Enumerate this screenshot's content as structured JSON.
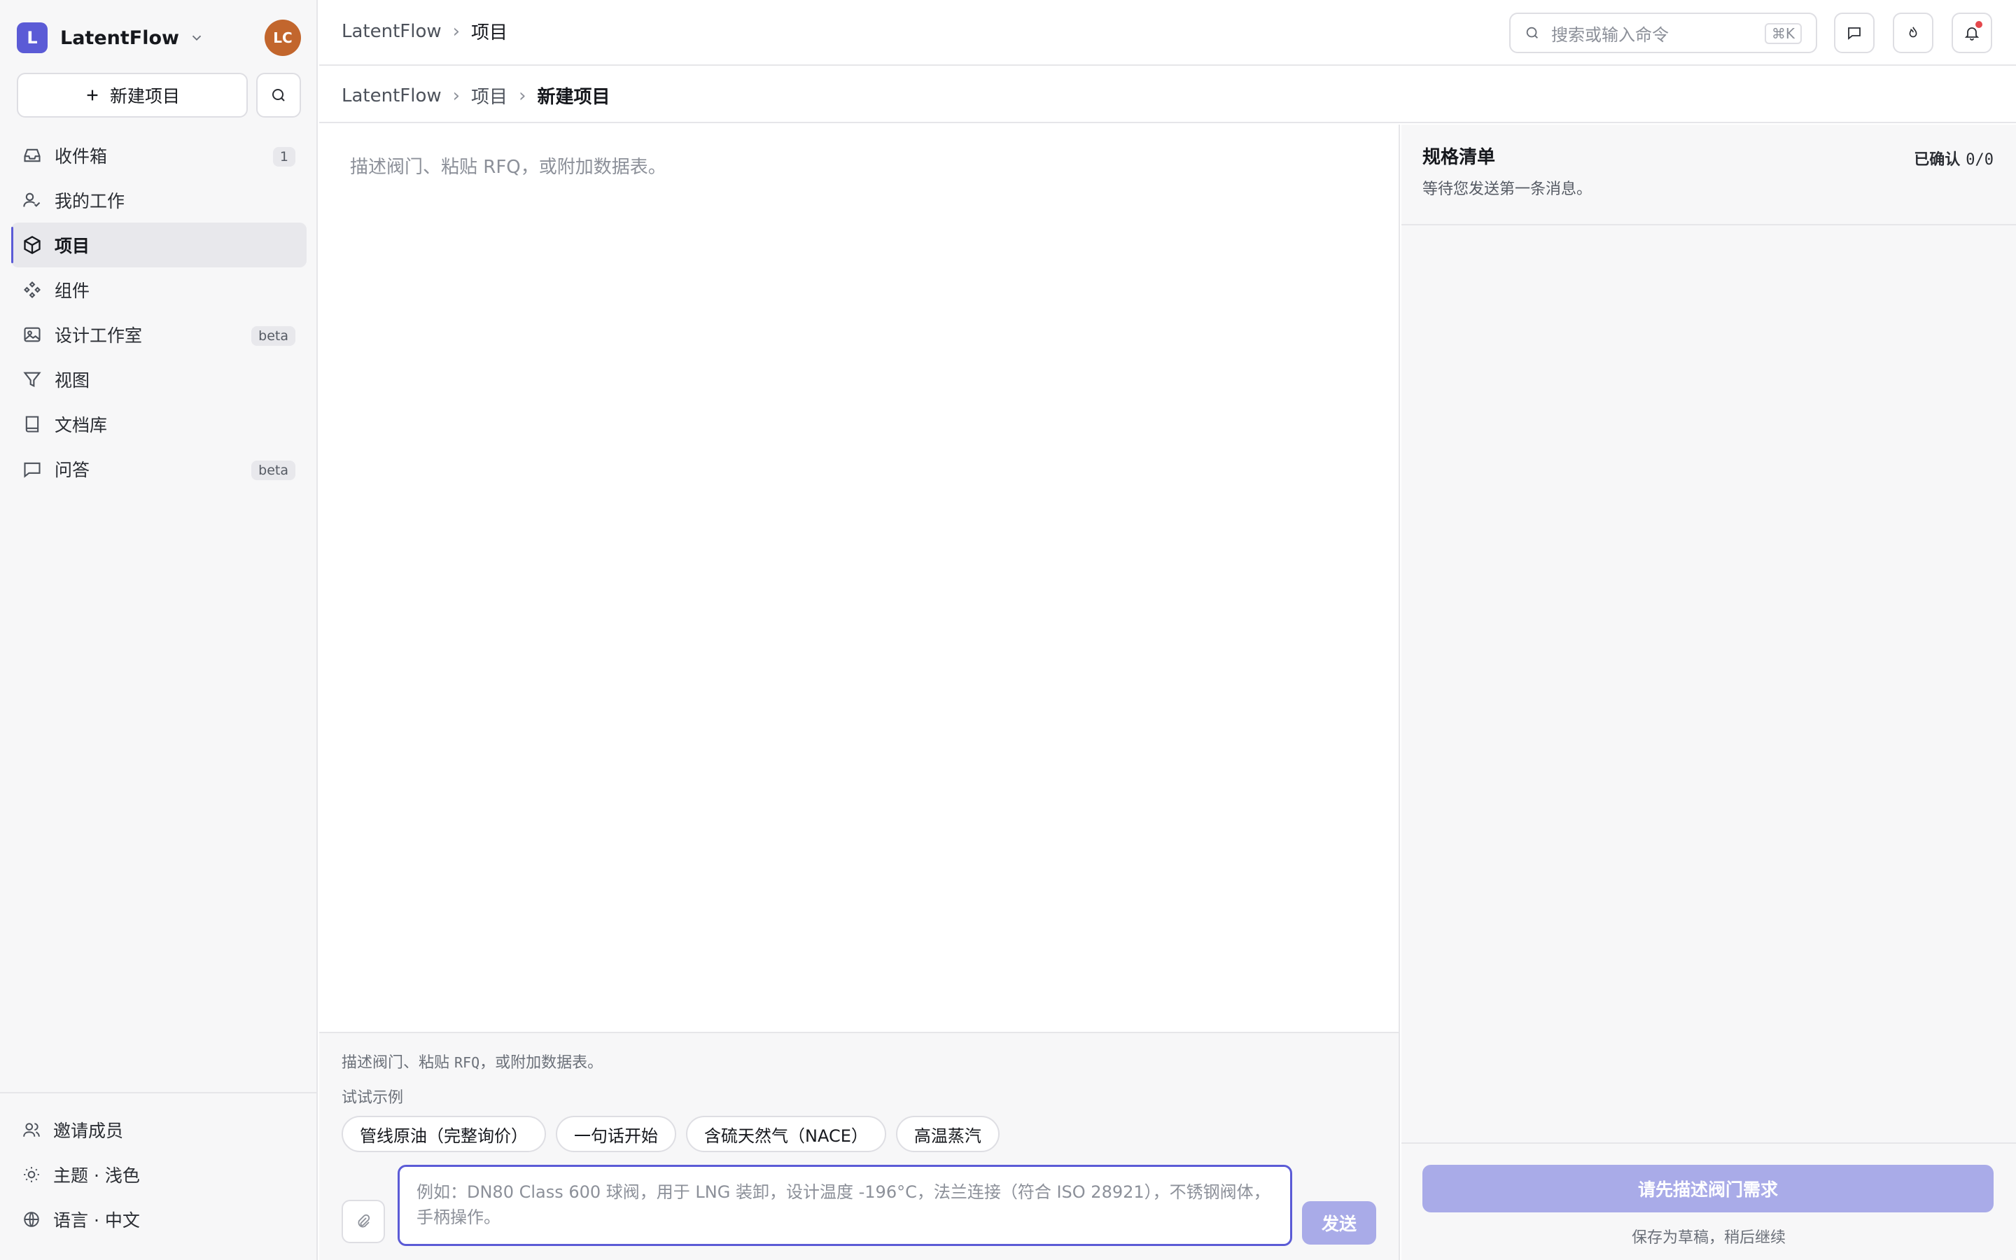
{
  "brand": {
    "logo_letter": "L",
    "name": "LatentFlow",
    "avatar": "LC",
    "accent": "#5b5bd6"
  },
  "sidebar": {
    "new_project": "新建项目",
    "items": [
      {
        "label": "收件箱",
        "badge": "1",
        "icon": "inbox-icon"
      },
      {
        "label": "我的工作",
        "badge": "",
        "icon": "user-check-icon"
      },
      {
        "label": "项目",
        "badge": "",
        "icon": "cube-icon",
        "active": true
      },
      {
        "label": "组件",
        "badge": "",
        "icon": "components-icon"
      },
      {
        "label": "设计工作室",
        "badge": "beta",
        "icon": "image-icon"
      },
      {
        "label": "视图",
        "badge": "",
        "icon": "filter-icon"
      },
      {
        "label": "文档库",
        "badge": "",
        "icon": "book-icon"
      },
      {
        "label": "问答",
        "badge": "beta",
        "icon": "message-icon"
      }
    ],
    "bottom": [
      {
        "label": "邀请成员",
        "icon": "users-icon"
      },
      {
        "label": "主题 · 浅色",
        "icon": "sun-icon"
      },
      {
        "label": "语言 · 中文",
        "icon": "globe-icon"
      }
    ]
  },
  "topbar": {
    "breadcrumb": [
      "LatentFlow",
      "项目"
    ],
    "search_placeholder": "搜索或输入命令",
    "shortcut": "⌘K"
  },
  "subbar": {
    "breadcrumb": [
      "LatentFlow",
      "项目",
      "新建项目"
    ]
  },
  "chat": {
    "placeholder": "描述阀门、粘贴 RFQ，或附加数据表。",
    "hint_prefix": "描述阀门、粘贴 ",
    "hint_code": "RFQ",
    "hint_suffix": "，或附加数据表。",
    "examples_label": "试试示例",
    "examples": [
      "管线原油（完整询价）",
      "一句话开始",
      "含硫天然气（NACE）",
      "高温蒸汽"
    ],
    "input_placeholder": "例如：DN80 Class 600 球阀，用于 LNG 装卸，设计温度 -196°C，法兰连接（符合 ISO 28921），不锈钢阀体，手柄操作。",
    "send": "发送"
  },
  "spec": {
    "title": "规格清单",
    "subtitle": "等待您发送第一条消息。",
    "confirmed_label": "已确认",
    "confirmed_count": "0/0",
    "cta": "请先描述阀门需求",
    "save_draft": "保存为草稿，稍后继续"
  }
}
